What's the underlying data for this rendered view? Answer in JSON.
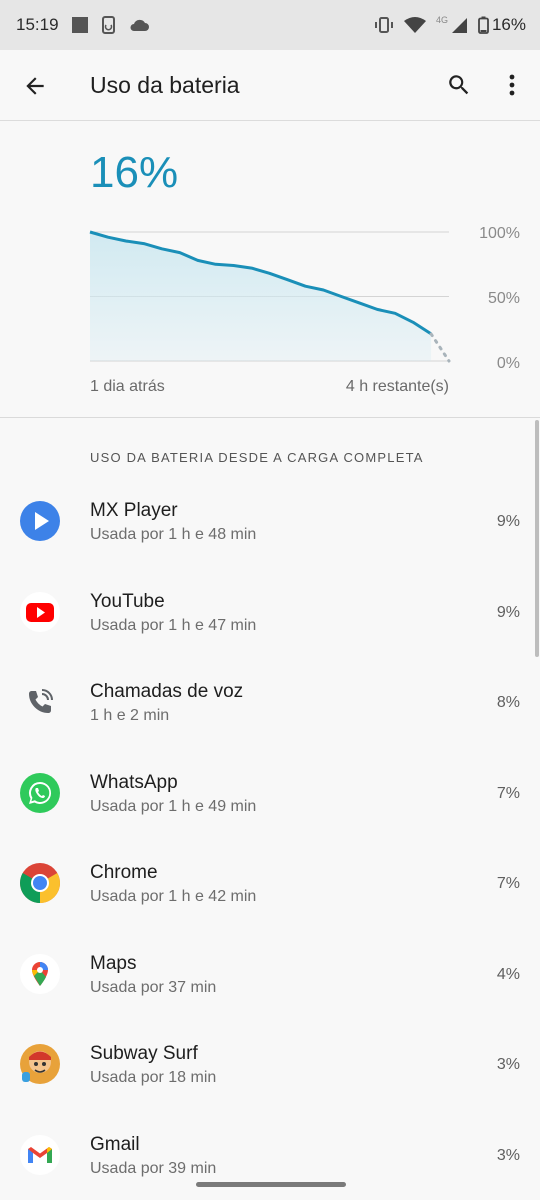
{
  "status_bar": {
    "time": "15:19",
    "network_label": "4G",
    "battery_percent": "16%"
  },
  "app_bar": {
    "title": "Uso da bateria"
  },
  "battery_level": "16%",
  "chart_data": {
    "type": "area",
    "x": [
      0,
      0.05,
      0.1,
      0.15,
      0.2,
      0.25,
      0.3,
      0.35,
      0.4,
      0.45,
      0.5,
      0.55,
      0.6,
      0.65,
      0.7,
      0.75,
      0.8,
      0.85,
      0.9,
      0.95
    ],
    "series": [
      {
        "values": [
          100,
          96,
          93,
          91,
          87,
          84,
          78,
          75,
          74,
          72,
          68,
          63,
          58,
          55,
          50,
          45,
          40,
          37,
          30,
          21
        ]
      }
    ],
    "projection": [
      [
        0.95,
        21
      ],
      [
        1.0,
        0
      ]
    ],
    "ylim": [
      0,
      100
    ],
    "y_tick_labels": [
      "100%",
      "50%",
      "0%"
    ],
    "x_start_label": "1 dia atrás",
    "x_end_label": "4 h restante(s)",
    "line_color": "#1a8fb8",
    "fill_color": "#cfe9f1"
  },
  "section_header": "USO DA BATERIA DESDE A CARGA COMPLETA",
  "apps": [
    {
      "name": "MX Player",
      "detail": "Usada por 1 h e 48 min",
      "percent": "9%",
      "icon": "mx-player-icon"
    },
    {
      "name": "YouTube",
      "detail": "Usada por 1 h e 47 min",
      "percent": "9%",
      "icon": "youtube-icon"
    },
    {
      "name": "Chamadas de voz",
      "detail": "1 h e 2 min",
      "percent": "8%",
      "icon": "phone-icon"
    },
    {
      "name": "WhatsApp",
      "detail": "Usada por 1 h e 49 min",
      "percent": "7%",
      "icon": "whatsapp-icon"
    },
    {
      "name": "Chrome",
      "detail": "Usada por 1 h e 42 min",
      "percent": "7%",
      "icon": "chrome-icon"
    },
    {
      "name": "Maps",
      "detail": "Usada por 37 min",
      "percent": "4%",
      "icon": "maps-icon"
    },
    {
      "name": "Subway Surf",
      "detail": "Usada por 18 min",
      "percent": "3%",
      "icon": "subway-surf-icon"
    },
    {
      "name": "Gmail",
      "detail": "Usada por 39 min",
      "percent": "3%",
      "icon": "gmail-icon"
    }
  ]
}
